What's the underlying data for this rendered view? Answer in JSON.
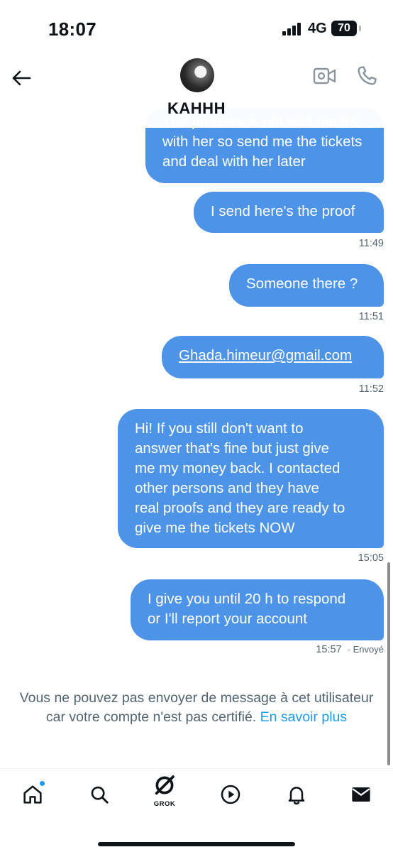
{
  "status_bar": {
    "time": "18:07",
    "network": "4G",
    "battery": "70"
  },
  "header": {
    "name": "KAHHH",
    "icons": [
      "back-arrow-icon",
      "video-call-icon",
      "phone-icon"
    ]
  },
  "messages": [
    {
      "lines": [
        "The problem is not with me it's",
        "with her so send me the tickets",
        "and deal with her later"
      ],
      "time": ""
    },
    {
      "lines": [
        "I send here's the proof"
      ],
      "time": "11:49"
    },
    {
      "lines": [
        "Someone there ?"
      ],
      "time": "11:51"
    },
    {
      "lines": [
        "Ghada.himeur@gmail.com"
      ],
      "time": "11:52"
    },
    {
      "lines": [
        "Hi! If you still don't want to",
        "answer that's fine but just give",
        "me my money back. I contacted",
        "other persons and they have",
        "real proofs and they are ready to",
        "give me the tickets NOW"
      ],
      "time": "15:05"
    },
    {
      "lines": [
        "I give you until 20 h to respond",
        "or I'll report your account"
      ],
      "time": "15:57",
      "status": "· Envoyé"
    }
  ],
  "notice": {
    "line1": "Vous ne pouvez pas envoyer de message à cet utilisateur",
    "line2": "car votre compte n'est pas certifié.",
    "link": "En savoir plus"
  },
  "nav": {
    "grok_label": "GROK",
    "icons": [
      "home-icon",
      "search-icon",
      "grok-icon",
      "video-icon",
      "notifications-icon",
      "messages-icon"
    ]
  },
  "colors": {
    "bubble": "#4d94e8",
    "link": "#1d9bf0",
    "muted": "#536471"
  }
}
